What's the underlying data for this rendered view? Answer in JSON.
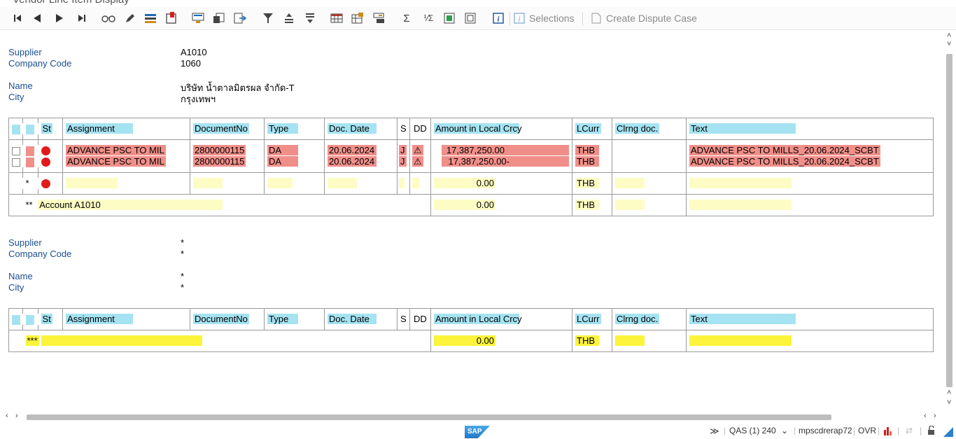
{
  "window": {
    "title": "Vendor Line Item Display"
  },
  "toolbar": {
    "icons": [
      "first-page-icon",
      "previous-page-icon",
      "next-page-icon",
      "last-page-icon",
      "glasses-icon",
      "pencil-icon",
      "mass-change-icon",
      "alert-icon",
      "detail-icon",
      "copy-icon",
      "export-icon",
      "filter-icon",
      "sort-ascending-icon",
      "sort-descending-icon",
      "layout-icon",
      "change-layout-icon",
      "save-layout-icon",
      "sum-icon",
      "subtotal-icon",
      "select-all-icon",
      "deselect-all-icon",
      "info-icon"
    ],
    "selections_label": "Selections",
    "create_dispute_label": "Create Dispute Case"
  },
  "section1": {
    "labels": {
      "supplier": "Supplier",
      "company_code": "Company Code",
      "name": "Name",
      "city": "City"
    },
    "values": {
      "supplier": "A1010",
      "company_code": "1060",
      "name": "บริษัท น้ำตาลมิตรผล จำกัด-T",
      "city": "กรุงเทพฯ"
    },
    "columns": {
      "st": "St",
      "assignment": "Assignment",
      "document_no": "DocumentNo",
      "type": "Type",
      "doc_date": "Doc. Date",
      "s": "S",
      "dd": "DD",
      "amount": "Amount in Local Crcy",
      "lcurr": "LCurr",
      "clrng_doc": "Clrng doc.",
      "text": "Text"
    },
    "rows": [
      {
        "assignment": "ADVANCE PSC TO MIL",
        "document_no": "2800000115",
        "type": "DA",
        "doc_date": "20.06.2024",
        "s": "J",
        "amount": "17,387,250.00",
        "lcurr": "THB",
        "clrng_doc": "",
        "text": "ADVANCE PSC TO MILLS_20.06.2024_SCBT"
      },
      {
        "assignment": "ADVANCE PSC TO MIL",
        "document_no": "2800000115",
        "type": "DA",
        "doc_date": "20.06.2024",
        "s": "J",
        "amount": "17,387,250.00-",
        "lcurr": "THB",
        "clrng_doc": "",
        "text": "ADVANCE PSC TO MILLS_20.06.2024_SCBT"
      }
    ],
    "subtotal": {
      "marker": "*",
      "amount": "0.00",
      "lcurr": "THB"
    },
    "account_total": {
      "marker": "**",
      "label": "Account A1010",
      "amount": "0.00",
      "lcurr": "THB"
    }
  },
  "section2": {
    "labels": {
      "supplier": "Supplier",
      "company_code": "Company Code",
      "name": "Name",
      "city": "City"
    },
    "values": {
      "supplier": "*",
      "company_code": "*",
      "name": "*",
      "city": "*"
    },
    "columns": {
      "st": "St",
      "assignment": "Assignment",
      "document_no": "DocumentNo",
      "type": "Type",
      "doc_date": "Doc. Date",
      "s": "S",
      "dd": "DD",
      "amount": "Amount in Local Crcy",
      "lcurr": "LCurr",
      "clrng_doc": "Clrng doc.",
      "text": "Text"
    },
    "grand_total": {
      "marker": "***",
      "amount": "0.00",
      "lcurr": "THB"
    }
  },
  "statusbar": {
    "logo": "SAP",
    "system": "QAS (1) 240",
    "server": "mpscdrerap72",
    "mode": "OVR"
  },
  "colors": {
    "header_cyan": "#a5e3f2",
    "error_red": "#f08f8a",
    "subtotal_yellow": "#fdfcc4",
    "total_yellow": "#fbf43a",
    "status_red": "#e01a1a",
    "label_blue": "#1b4f8f"
  }
}
